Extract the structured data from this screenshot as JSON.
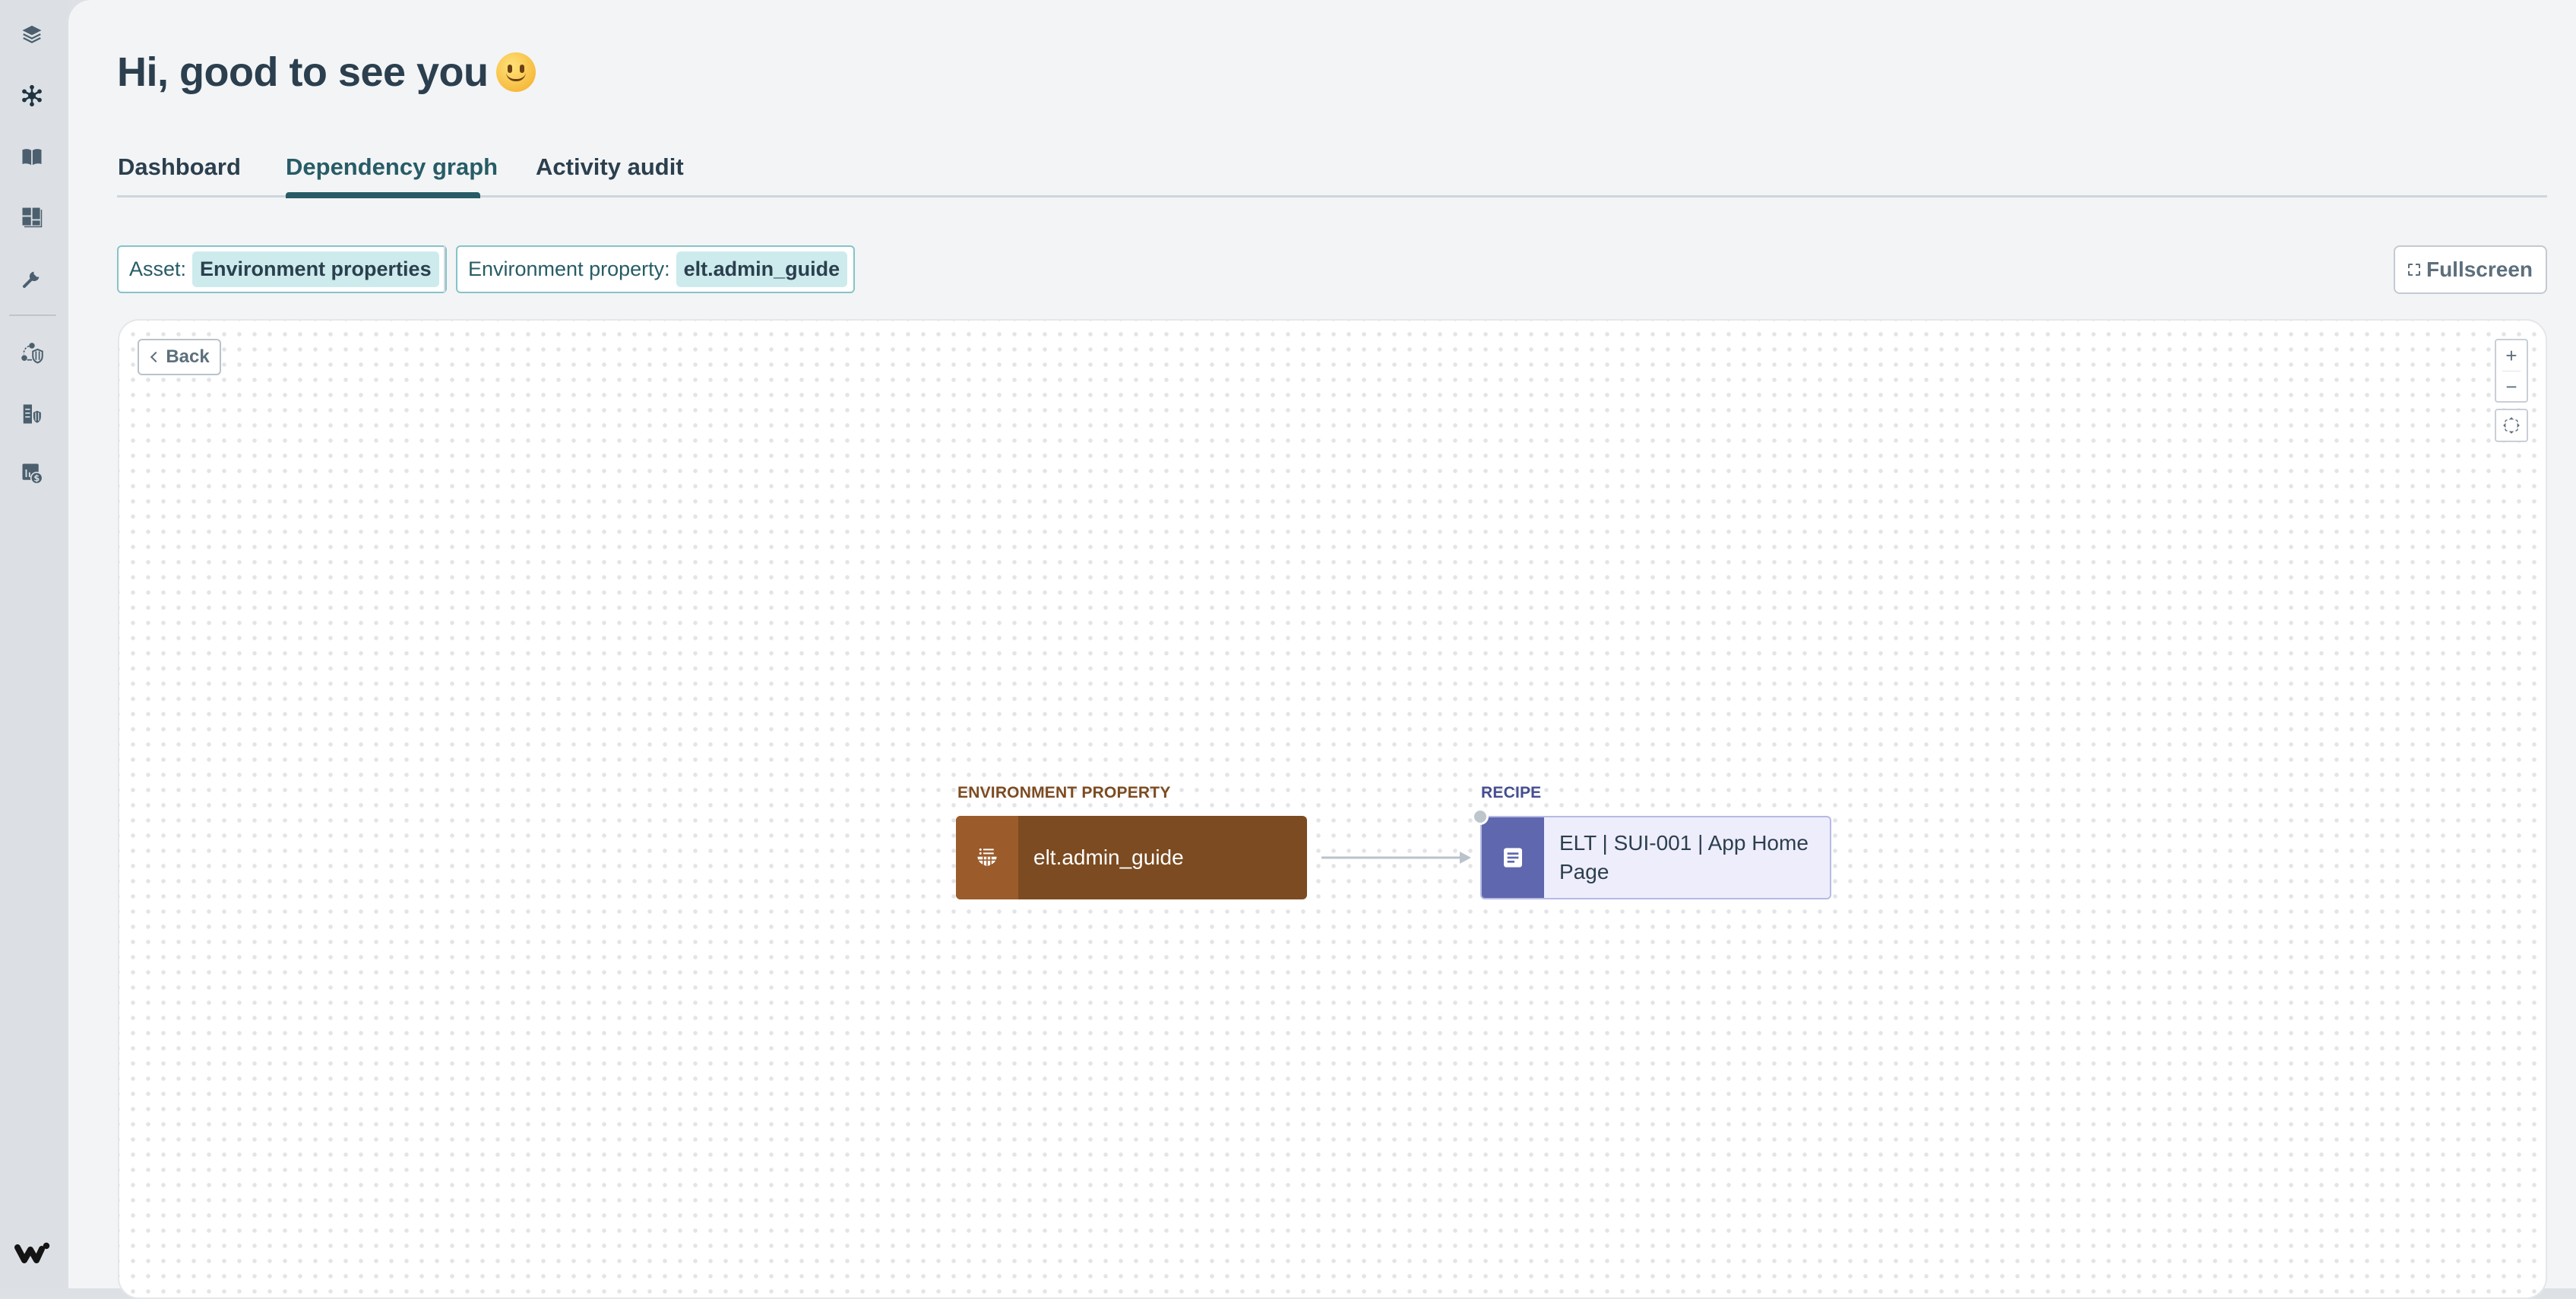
{
  "sidebar": {
    "items": [
      {
        "icon": "layers-icon",
        "label": "Assets"
      },
      {
        "icon": "network-icon",
        "label": "Dependency graph",
        "active": true
      },
      {
        "icon": "book-icon",
        "label": "Docs"
      },
      {
        "icon": "dashboard-icon",
        "label": "Dashboards"
      },
      {
        "icon": "wrench-icon",
        "label": "Tools"
      },
      {
        "icon": "network-shield-icon",
        "label": "Network security"
      },
      {
        "icon": "building-shield-icon",
        "label": "Workspace security"
      },
      {
        "icon": "billing-icon",
        "label": "Billing"
      }
    ],
    "logo": "workato-logo"
  },
  "header": {
    "title": "Hi, good to see you",
    "emoji": "slightly-smiling-face"
  },
  "tabs": [
    {
      "label": "Dashboard",
      "active": false
    },
    {
      "label": "Dependency graph",
      "active": true
    },
    {
      "label": "Activity audit",
      "active": false
    }
  ],
  "filters": [
    {
      "label": "Asset:",
      "value": "Environment properties"
    },
    {
      "label": "Environment property:",
      "value": "elt.admin_guide"
    }
  ],
  "toolbar": {
    "fullscreen_label": "Fullscreen",
    "back_label": "Back",
    "zoom_in": "+",
    "zoom_out": "−"
  },
  "graph": {
    "nodes": [
      {
        "type_label": "ENVIRONMENT PROPERTY",
        "name": "elt.admin_guide",
        "icon": "environment-property-icon",
        "color": "#7c4b21",
        "accent": "#9c5b2a"
      },
      {
        "type_label": "RECIPE",
        "name": "ELT | SUI-001 | App Home Page",
        "icon": "recipe-icon",
        "color": "#5f68ae",
        "background": "#eeedfc"
      }
    ],
    "edges": [
      {
        "from": "elt.admin_guide",
        "to": "ELT | SUI-001 | App Home Page"
      }
    ]
  },
  "colors": {
    "primary": "#275c66",
    "text": "#2b3f4e",
    "chip_bg": "#cdebec",
    "chip_border": "#86c3c9"
  }
}
